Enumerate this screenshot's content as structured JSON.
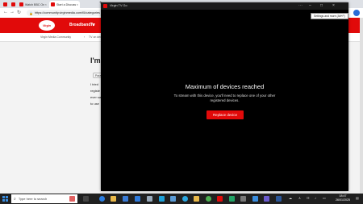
{
  "browser": {
    "tabs": [
      {
        "title": "",
        "color": "#e10a0a"
      },
      {
        "title": "",
        "color": "#e10a0a"
      },
      {
        "title": "Watch BBC One North East",
        "color": "#e10a0a"
      },
      {
        "title": "Start a Discussion",
        "color": "#e10a0a"
      }
    ],
    "new_tab": "+",
    "url": "https://community.virginmedia.com/t5/categories"
  },
  "site": {
    "logo": "Virgin",
    "nav": [
      "Broadband ∨",
      "Tv"
    ],
    "breadcrumbs": [
      "Virgin Media Community",
      "›",
      "TV on demand"
    ],
    "title": "I'm",
    "page_pill": "Parag",
    "body_lines": [
      "I tried",
      "registe",
      "ever sa",
      "to use"
    ]
  },
  "overlay": {
    "title": "Virgin TV Go",
    "tooltip": "Settings and more (Alt+F)",
    "heading": "Maximum of devices reached",
    "message": "To stream with this device, you'll need to replace one of your other registered devices.",
    "button": "Replace device",
    "accent": "#e10a0a"
  },
  "taskbar": {
    "search_placeholder": "Type here to search",
    "time": "18:47",
    "date": "26/01/2025"
  }
}
